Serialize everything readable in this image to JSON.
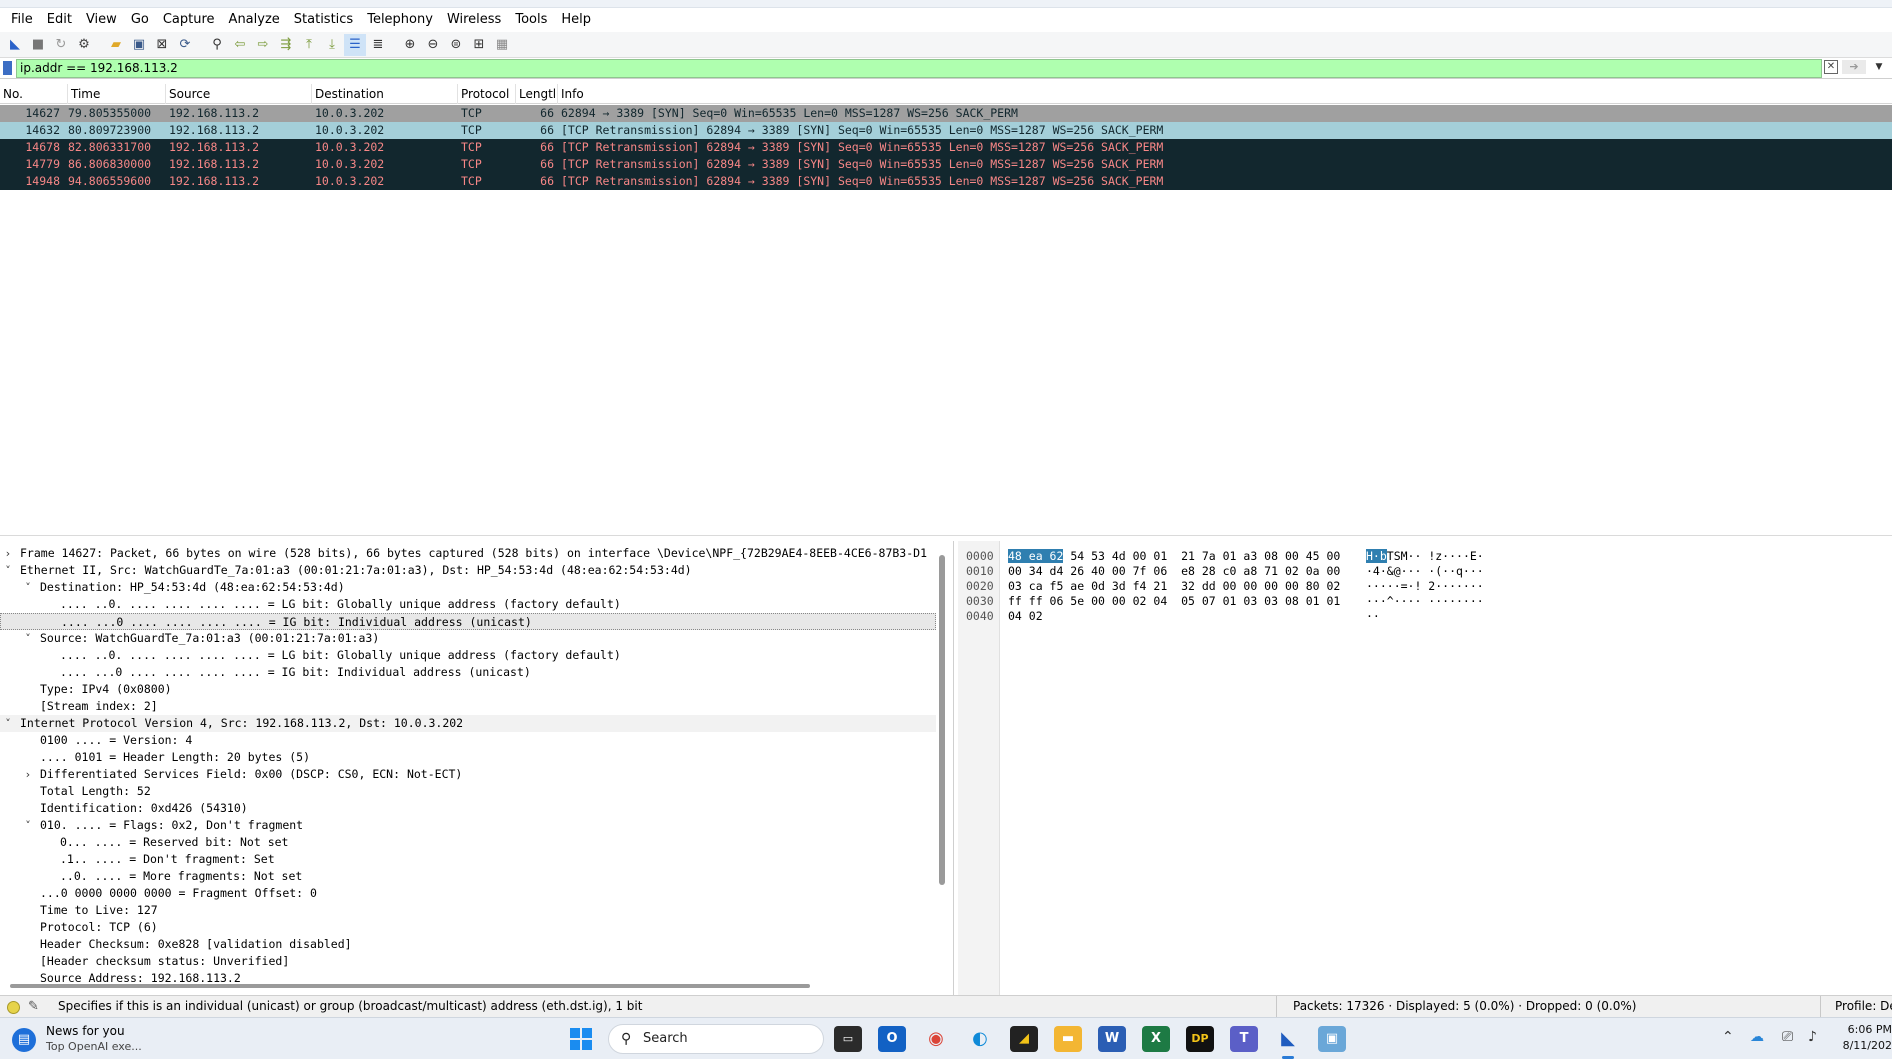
{
  "menu": [
    "File",
    "Edit",
    "View",
    "Go",
    "Capture",
    "Analyze",
    "Statistics",
    "Telephony",
    "Wireless",
    "Tools",
    "Help"
  ],
  "toolbar": {
    "icons": [
      "shark-fin-start-icon",
      "stop-icon",
      "restart-icon",
      "options-gear-icon",
      "open-folder-icon",
      "save-icon",
      "close-file-icon",
      "reload-icon",
      "find-icon",
      "back-arrow-icon",
      "forward-arrow-icon",
      "go-to-packet-icon",
      "first-packet-icon",
      "last-packet-icon",
      "autoscroll-icon",
      "colorize-icon",
      "zoom-in-icon",
      "zoom-out-icon",
      "normal-size-icon",
      "resize-columns-icon",
      "layout-icon"
    ]
  },
  "filter": {
    "value": "ip.addr == 192.168.113.2"
  },
  "packet_list": {
    "columns": [
      "No.",
      "Time",
      "Source",
      "Destination",
      "Protocol",
      "Lengtl",
      "Info"
    ],
    "rows": [
      {
        "no": "14627",
        "time": "79.805355000",
        "src": "192.168.113.2",
        "dst": "10.0.3.202",
        "proto": "TCP",
        "len": "66",
        "info": "62894 → 3389 [SYN] Seq=0 Win=65535 Len=0 MSS=1287 WS=256 SACK_PERM",
        "style": "sel"
      },
      {
        "no": "14632",
        "time": "80.809723900",
        "src": "192.168.113.2",
        "dst": "10.0.3.202",
        "proto": "TCP",
        "len": "66",
        "info": "[TCP Retransmission] 62894 → 3389 [SYN] Seq=0 Win=65535 Len=0 MSS=1287 WS=256 SACK_PERM",
        "style": "hl"
      },
      {
        "no": "14678",
        "time": "82.806331700",
        "src": "192.168.113.2",
        "dst": "10.0.3.202",
        "proto": "TCP",
        "len": "66",
        "info": "[TCP Retransmission] 62894 → 3389 [SYN] Seq=0 Win=65535 Len=0 MSS=1287 WS=256 SACK_PERM",
        "style": "dark"
      },
      {
        "no": "14779",
        "time": "86.806830000",
        "src": "192.168.113.2",
        "dst": "10.0.3.202",
        "proto": "TCP",
        "len": "66",
        "info": "[TCP Retransmission] 62894 → 3389 [SYN] Seq=0 Win=65535 Len=0 MSS=1287 WS=256 SACK_PERM",
        "style": "dark"
      },
      {
        "no": "14948",
        "time": "94.806559600",
        "src": "192.168.113.2",
        "dst": "10.0.3.202",
        "proto": "TCP",
        "len": "66",
        "info": "[TCP Retransmission] 62894 → 3389 [SYN] Seq=0 Win=65535 Len=0 MSS=1287 WS=256 SACK_PERM",
        "style": "dark"
      }
    ]
  },
  "details": [
    {
      "indent": 0,
      "toggle": "›",
      "text": "Frame 14627: Packet, 66 bytes on wire (528 bits), 66 bytes captured (528 bits) on interface \\Device\\NPF_{72B29AE4-8EEB-4CE6-87B3-D1",
      "style": ""
    },
    {
      "indent": 0,
      "toggle": "˅",
      "text": "Ethernet II, Src: WatchGuardTe_7a:01:a3 (00:01:21:7a:01:a3), Dst: HP_54:53:4d (48:ea:62:54:53:4d)",
      "style": ""
    },
    {
      "indent": 1,
      "toggle": "˅",
      "text": "Destination: HP_54:53:4d (48:ea:62:54:53:4d)",
      "style": ""
    },
    {
      "indent": 2,
      "toggle": "",
      "text": ".... ..0. .... .... .... .... = LG bit: Globally unique address (factory default)",
      "style": ""
    },
    {
      "indent": 2,
      "toggle": "",
      "text": ".... ...0 .... .... .... .... = IG bit: Individual address (unicast)",
      "style": "sel"
    },
    {
      "indent": 1,
      "toggle": "˅",
      "text": "Source: WatchGuardTe_7a:01:a3 (00:01:21:7a:01:a3)",
      "style": ""
    },
    {
      "indent": 2,
      "toggle": "",
      "text": ".... ..0. .... .... .... .... = LG bit: Globally unique address (factory default)",
      "style": ""
    },
    {
      "indent": 2,
      "toggle": "",
      "text": ".... ...0 .... .... .... .... = IG bit: Individual address (unicast)",
      "style": ""
    },
    {
      "indent": 1,
      "toggle": "",
      "text": "Type: IPv4 (0x0800)",
      "style": ""
    },
    {
      "indent": 1,
      "toggle": "",
      "text": "[Stream index: 2]",
      "style": ""
    },
    {
      "indent": 0,
      "toggle": "˅",
      "text": "Internet Protocol Version 4, Src: 192.168.113.2, Dst: 10.0.3.202",
      "style": "grp"
    },
    {
      "indent": 1,
      "toggle": "",
      "text": "0100 .... = Version: 4",
      "style": ""
    },
    {
      "indent": 1,
      "toggle": "",
      "text": ".... 0101 = Header Length: 20 bytes (5)",
      "style": ""
    },
    {
      "indent": 1,
      "toggle": "›",
      "text": "Differentiated Services Field: 0x00 (DSCP: CS0, ECN: Not-ECT)",
      "style": ""
    },
    {
      "indent": 1,
      "toggle": "",
      "text": "Total Length: 52",
      "style": ""
    },
    {
      "indent": 1,
      "toggle": "",
      "text": "Identification: 0xd426 (54310)",
      "style": ""
    },
    {
      "indent": 1,
      "toggle": "˅",
      "text": "010. .... = Flags: 0x2, Don't fragment",
      "style": ""
    },
    {
      "indent": 2,
      "toggle": "",
      "text": "0... .... = Reserved bit: Not set",
      "style": ""
    },
    {
      "indent": 2,
      "toggle": "",
      "text": ".1.. .... = Don't fragment: Set",
      "style": ""
    },
    {
      "indent": 2,
      "toggle": "",
      "text": "..0. .... = More fragments: Not set",
      "style": ""
    },
    {
      "indent": 1,
      "toggle": "",
      "text": "...0 0000 0000 0000 = Fragment Offset: 0",
      "style": ""
    },
    {
      "indent": 1,
      "toggle": "",
      "text": "Time to Live: 127",
      "style": ""
    },
    {
      "indent": 1,
      "toggle": "",
      "text": "Protocol: TCP (6)",
      "style": ""
    },
    {
      "indent": 1,
      "toggle": "",
      "text": "Header Checksum: 0xe828 [validation disabled]",
      "style": ""
    },
    {
      "indent": 1,
      "toggle": "",
      "text": "[Header checksum status: Unverified]",
      "style": ""
    },
    {
      "indent": 1,
      "toggle": "",
      "text": "Source Address: 192.168.113.2",
      "style": ""
    }
  ],
  "bytes": [
    {
      "offset": "0000",
      "hex_sel": "48 ea 62",
      "hex": " 54 53 4d 00 01  21 7a 01 a3 08 00 45 00",
      "ascii_sel": "H·b",
      "ascii": "TSM·· !z····E·"
    },
    {
      "offset": "0010",
      "hex_sel": "",
      "hex": "00 34 d4 26 40 00 7f 06  e8 28 c0 a8 71 02 0a 00",
      "ascii_sel": "",
      "ascii": "·4·&@··· ·(··q···"
    },
    {
      "offset": "0020",
      "hex_sel": "",
      "hex": "03 ca f5 ae 0d 3d f4 21  32 dd 00 00 00 00 80 02",
      "ascii_sel": "",
      "ascii": "·····=·! 2·······"
    },
    {
      "offset": "0030",
      "hex_sel": "",
      "hex": "ff ff 06 5e 00 00 02 04  05 07 01 03 03 08 01 01",
      "ascii_sel": "",
      "ascii": "···^···· ········"
    },
    {
      "offset": "0040",
      "hex_sel": "",
      "hex": "04 02",
      "ascii_sel": "",
      "ascii": "··"
    }
  ],
  "status": {
    "message": "Specifies if this is an individual (unicast) or group (broadcast/multicast) address (eth.dst.ig), 1 bit",
    "packets": "Packets: 17326 · Displayed: 5 (0.0%) · Dropped: 0 (0.0%)",
    "profile": "Profile: Def"
  },
  "taskbar": {
    "news_title": "News for you",
    "news_sub": "Top OpenAI exe...",
    "search_label": "Search",
    "time": "6:06 PM",
    "date": "8/11/202"
  },
  "colors": {
    "filter_bg": "#afffaf",
    "selected_row": "#a0a0a0",
    "highlight_row": "#a4cfd9",
    "retrans_bg": "#12272e",
    "retrans_fg": "#f78787"
  }
}
